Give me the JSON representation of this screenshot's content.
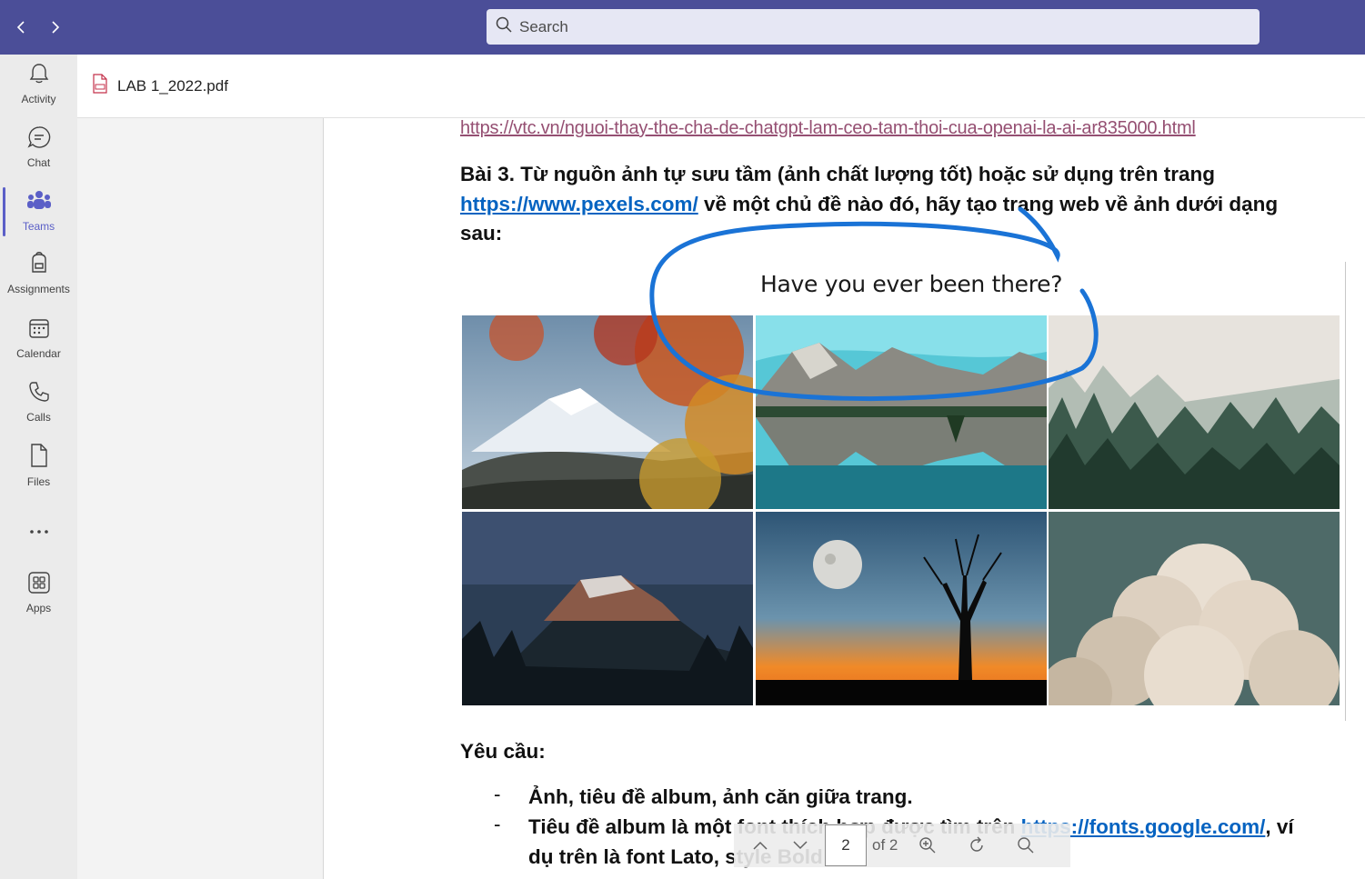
{
  "app": {
    "nav_back_icon": "chevron-left-icon",
    "nav_forward_icon": "chevron-right-icon",
    "search": {
      "placeholder": "Search",
      "value": ""
    },
    "accent": "#4b4e98",
    "active_color": "#5b5fc7"
  },
  "rail": {
    "items": [
      {
        "label": "Activity",
        "icon": "bell-icon"
      },
      {
        "label": "Chat",
        "icon": "chat-icon"
      },
      {
        "label": "Teams",
        "icon": "teams-icon",
        "active": true
      },
      {
        "label": "Assignments",
        "icon": "backpack-icon"
      },
      {
        "label": "Calendar",
        "icon": "calendar-icon"
      },
      {
        "label": "Calls",
        "icon": "phone-icon"
      },
      {
        "label": "Files",
        "icon": "file-icon"
      },
      {
        "label": "",
        "icon": "more-icon"
      },
      {
        "label": "Apps",
        "icon": "apps-icon"
      }
    ]
  },
  "file": {
    "name": "LAB 1_2022.pdf",
    "icon": "pdf-file-icon"
  },
  "doc": {
    "top_link": "https://vtc.vn/nguoi-thay-the-cha-de-chatgpt-lam-ceo-tam-thoi-cua-openai-la-ai-ar835000.html",
    "bai3_part1": "Bài 3. Từ nguồn ảnh tự sưu tầm (ảnh chất lượng tốt) hoặc sử dụng trên trang",
    "bai3_link": "https://www.pexels.com/",
    "bai3_part2": " về một chủ đề nào đó, hãy tạo trang web về ảnh dưới dạng",
    "bai3_part3": "sau:",
    "album_title": "Have you ever been there?",
    "photos": [
      "autumn-mountain-photo",
      "mountain-lake-photo",
      "misty-forest-photo",
      "night-mountain-photo",
      "moon-tree-photo",
      "clouds-photo"
    ],
    "yeu_cau": "Yêu cầu:",
    "req1": "Ảnh, tiêu đề album, ảnh căn giữa trang.",
    "req2_part1": "Tiêu đề album là một font thích hợp được tìm trên ",
    "req2_link": "https://fonts.google.com/",
    "req2_part2": ", ví",
    "req3": "dụ trên là font Lato, style Bold 700",
    "dash": "-"
  },
  "pdf_toolbar": {
    "page": "2",
    "of_label": "of 2",
    "icons": [
      "chevron-up-icon",
      "chevron-down-icon",
      "zoom-in-icon",
      "rotate-icon",
      "search-icon"
    ]
  }
}
